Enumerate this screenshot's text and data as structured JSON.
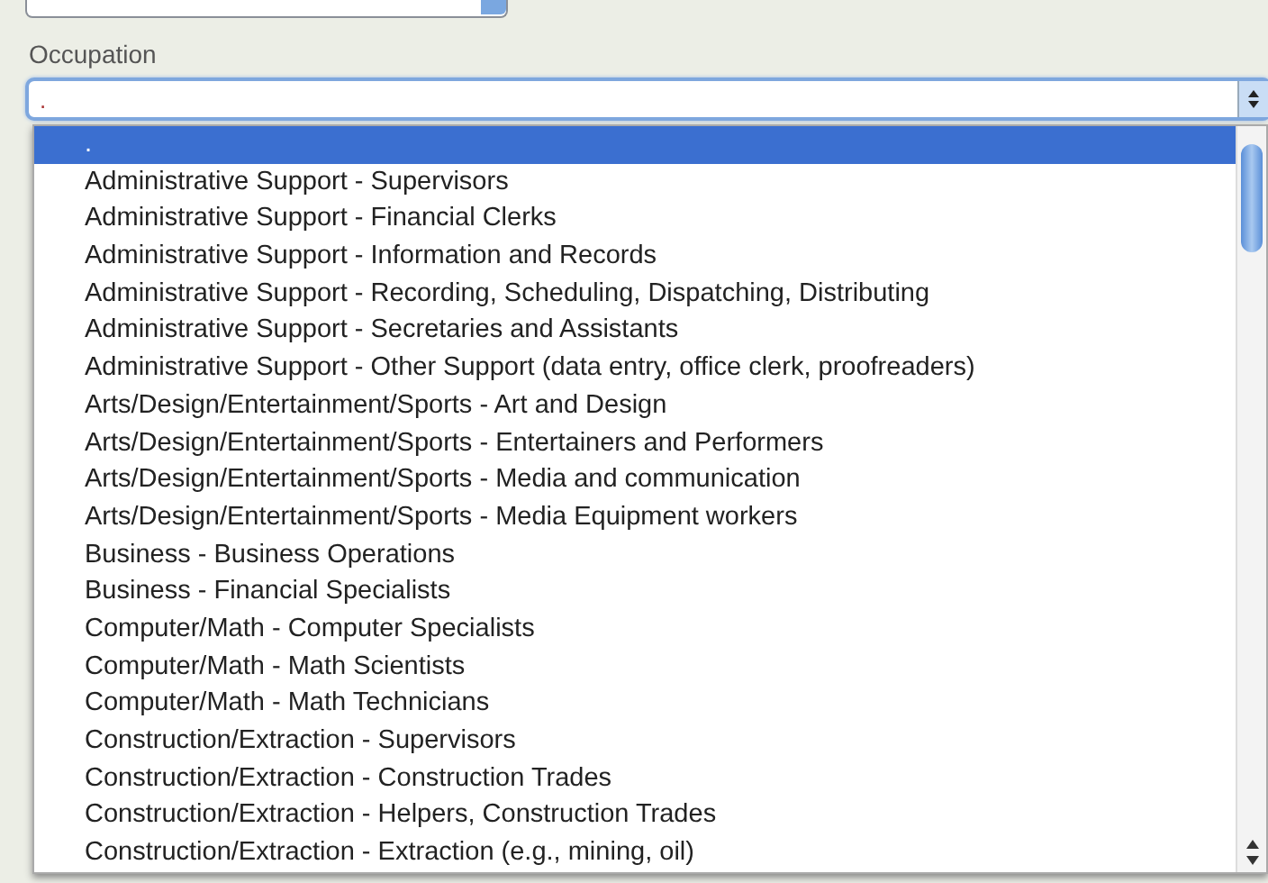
{
  "occupation": {
    "label": "Occupation",
    "value": ".",
    "expanded": true,
    "options": [
      {
        "label": ".",
        "selected": true
      },
      {
        "label": "Administrative Support - Supervisors",
        "selected": false
      },
      {
        "label": "Administrative Support - Financial Clerks",
        "selected": false
      },
      {
        "label": "Administrative Support - Information and Records",
        "selected": false
      },
      {
        "label": "Administrative Support - Recording, Scheduling, Dispatching, Distributing",
        "selected": false
      },
      {
        "label": "Administrative Support - Secretaries and Assistants",
        "selected": false
      },
      {
        "label": "Administrative Support - Other Support (data entry, office clerk, proofreaders)",
        "selected": false
      },
      {
        "label": "Arts/Design/Entertainment/Sports - Art and Design",
        "selected": false
      },
      {
        "label": "Arts/Design/Entertainment/Sports - Entertainers and Performers",
        "selected": false
      },
      {
        "label": "Arts/Design/Entertainment/Sports - Media and communication",
        "selected": false
      },
      {
        "label": "Arts/Design/Entertainment/Sports - Media Equipment workers",
        "selected": false
      },
      {
        "label": "Business - Business Operations",
        "selected": false
      },
      {
        "label": "Business - Financial Specialists",
        "selected": false
      },
      {
        "label": "Computer/Math - Computer Specialists",
        "selected": false
      },
      {
        "label": "Computer/Math - Math Scientists",
        "selected": false
      },
      {
        "label": "Computer/Math - Math Technicians",
        "selected": false
      },
      {
        "label": "Construction/Extraction - Supervisors",
        "selected": false
      },
      {
        "label": "Construction/Extraction - Construction Trades",
        "selected": false
      },
      {
        "label": "Construction/Extraction - Helpers, Construction Trades",
        "selected": false
      },
      {
        "label": "Construction/Extraction - Extraction (e.g., mining, oil)",
        "selected": false
      }
    ]
  }
}
